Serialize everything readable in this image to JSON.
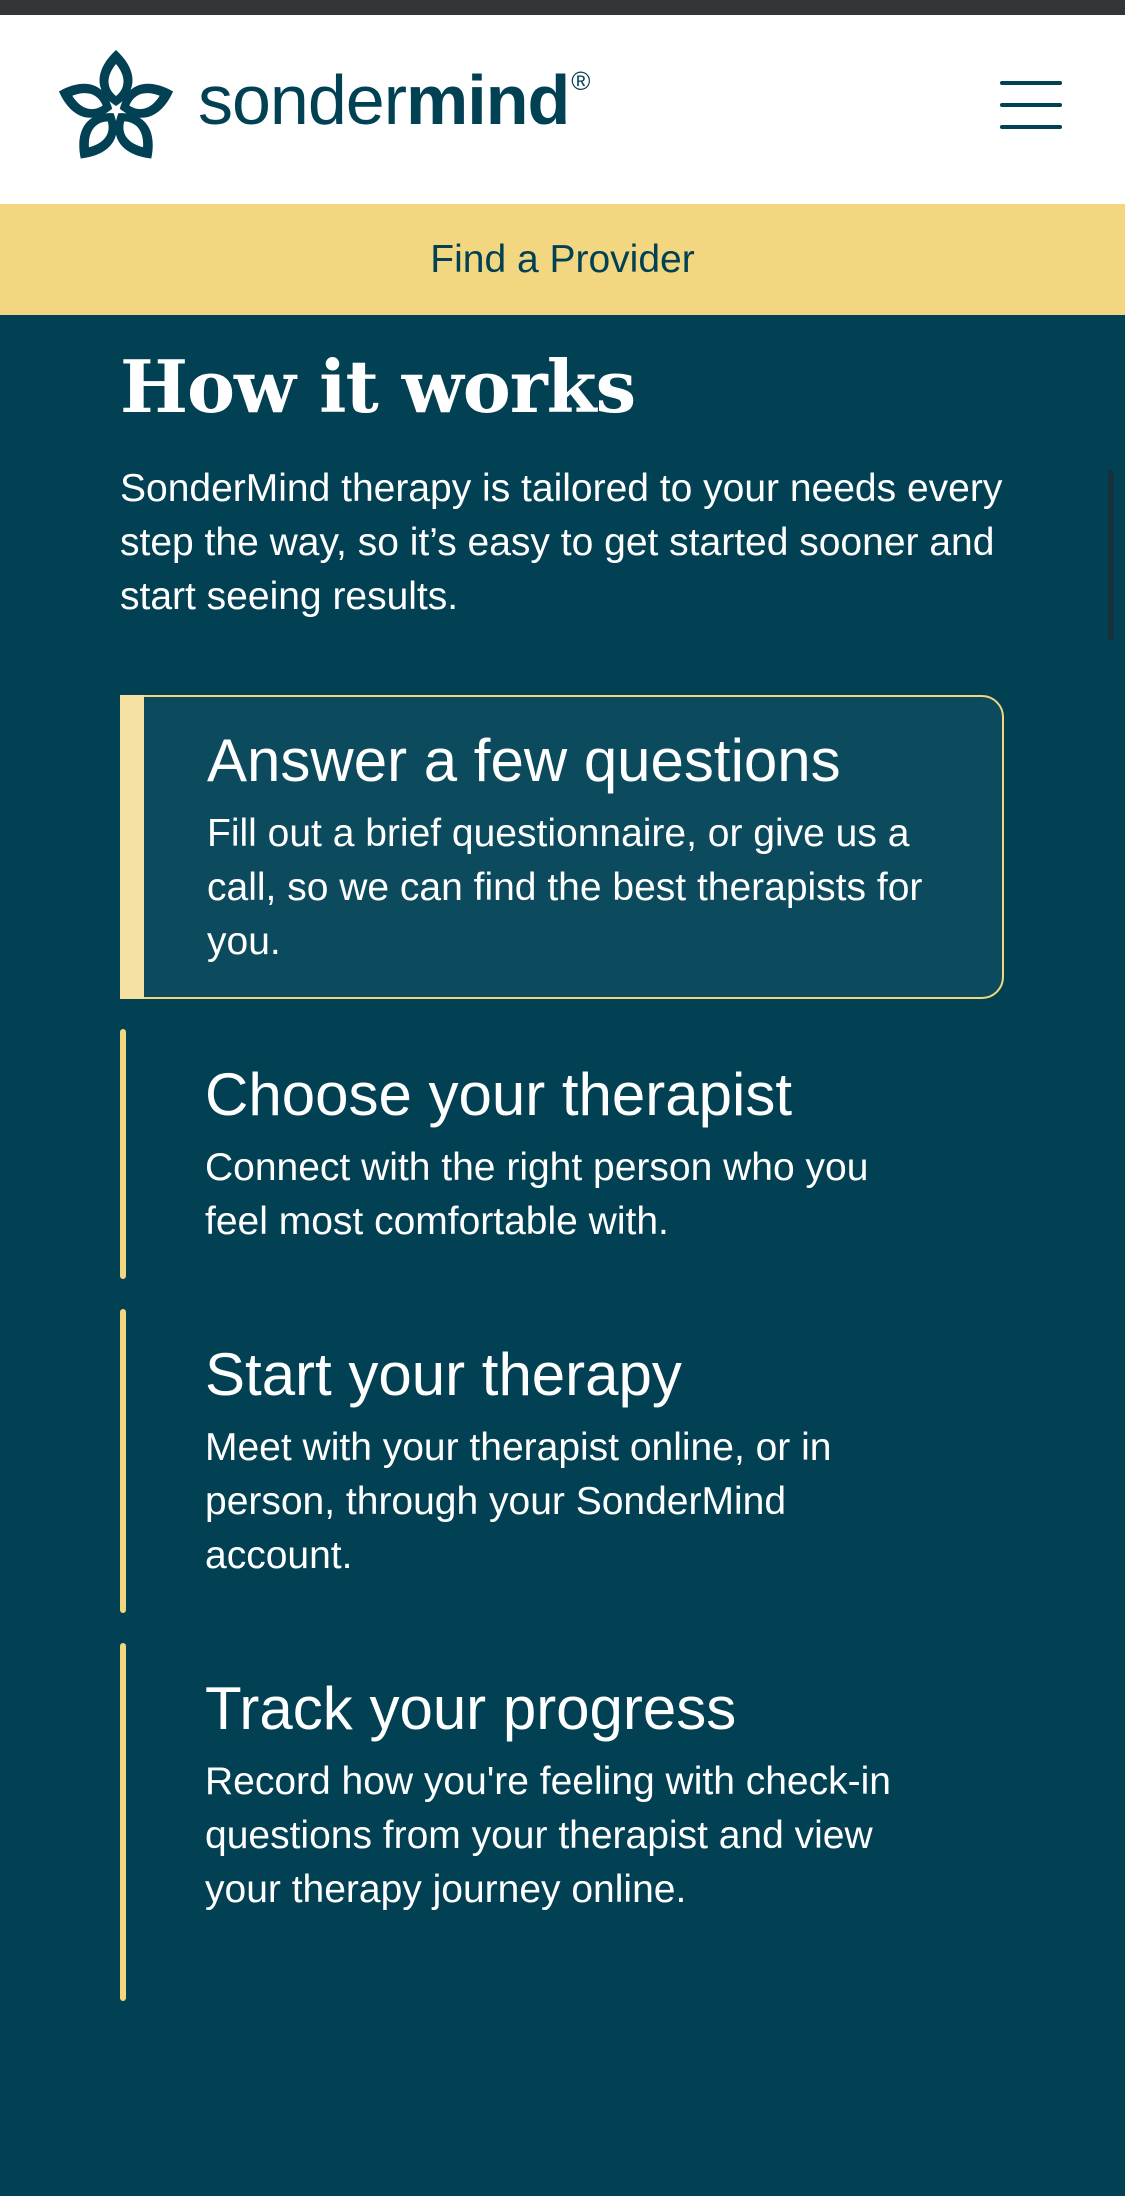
{
  "header": {
    "brand_light": "sonder",
    "brand_bold": "mind",
    "brand_mark": "®",
    "logo_icon": "sondermind-flower-icon",
    "menu_icon": "hamburger-menu-icon"
  },
  "banner": {
    "label": "Find a Provider"
  },
  "section": {
    "heading": "How it works",
    "intro": "SonderMind therapy is tailored to your needs every step the way, so it’s easy to get started sooner and start seeing results."
  },
  "steps": [
    {
      "title": "Answer a few questions",
      "desc": "Fill out a brief questionnaire, or give us a call, so we can find the best therapists for you.",
      "active": true
    },
    {
      "title": "Choose your therapist",
      "desc": "Connect with the right person who you feel most comfortable with."
    },
    {
      "title": "Start your therapy",
      "desc": "Meet with your therapist online, or in person, through your SonderMind account."
    },
    {
      "title": "Track your progress",
      "desc": "Record how you're feeling with check-in questions from your therapist and view your therapy journey online."
    }
  ],
  "colors": {
    "brand": "#024153",
    "accent": "#f2d680",
    "background": "#024153"
  }
}
